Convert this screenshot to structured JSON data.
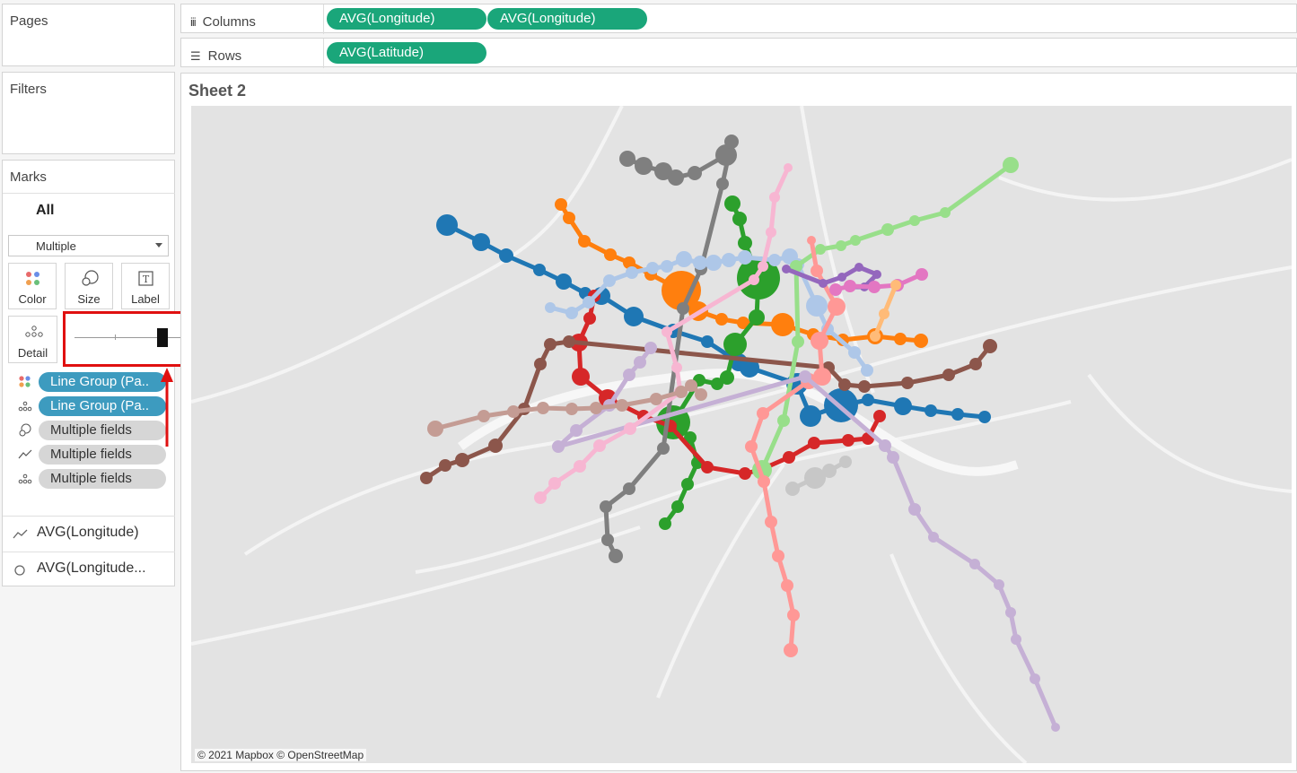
{
  "pages": {
    "title": "Pages"
  },
  "filters": {
    "title": "Filters"
  },
  "columns": {
    "label": "Columns",
    "pills": [
      "AVG(Longitude)",
      "AVG(Longitude)"
    ]
  },
  "rows": {
    "label": "Rows",
    "pills": [
      "AVG(Latitude)"
    ]
  },
  "marks": {
    "title": "Marks",
    "all_label": "All",
    "mark_type": "Multiple",
    "buttons": {
      "color": "Color",
      "size": "Size",
      "label": "Label",
      "detail": "Detail"
    },
    "fields": [
      {
        "text": "Line Group (Pa..",
        "kind": "color"
      },
      {
        "text": "Line Group (Pa..",
        "kind": "detail"
      },
      {
        "text": "Multiple fields",
        "kind": "size"
      },
      {
        "text": "Multiple fields",
        "kind": "path"
      },
      {
        "text": "Multiple fields",
        "kind": "detail"
      }
    ],
    "layers": [
      {
        "text": "AVG(Longitude)",
        "icon": "line-icon"
      },
      {
        "text": "AVG(Longitude...",
        "icon": "circle-icon"
      }
    ]
  },
  "sheet": {
    "title": "Sheet 2"
  },
  "map": {
    "attribution": "© 2021 Mapbox © OpenStreetMap"
  },
  "colors": {
    "pill_green": "#1aa67a",
    "pill_blue": "#3d9bbf",
    "highlight_red": "#e01010"
  }
}
